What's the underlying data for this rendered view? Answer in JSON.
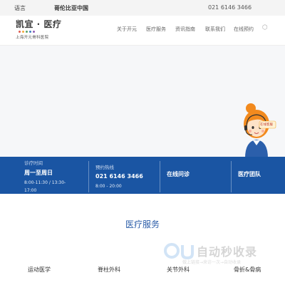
{
  "topbar": {
    "language": "语言",
    "promo": "哥伦比亚中国",
    "phone": "021 6146 3466"
  },
  "header": {
    "logo_name": "凯宜 · 医疗",
    "logo_sub": "上海开元骨科医院",
    "nav": [
      "关于开元",
      "医疗服务",
      "资讯指南",
      "联系我们",
      "在线预约"
    ],
    "nav_icon": "hexagon-icon",
    "dot_colors": [
      "#e05a4f",
      "#f2a93b",
      "#5aa469",
      "#3f7ec4",
      "#8e5bb5"
    ]
  },
  "info": {
    "hours_label": "诊疗时间",
    "hours_days": "周一至周日",
    "hours_time_1": "8:00-11:30 / 13:30-",
    "hours_time_2": "17:00",
    "hotline_label": "预约热线",
    "hotline_phone": "021 6146 3466",
    "hotline_time": "8:00 - 20:00",
    "consult": "在线问诊",
    "team": "医疗团队"
  },
  "services": {
    "title": "医疗服务",
    "items": [
      "运动医学",
      "脊柱外科",
      "关节外科",
      "骨折&骨病"
    ]
  },
  "watermark": {
    "brand": "自动秒收录",
    "slogan": "做上链接→来访一次→自动收录"
  },
  "avatar_badge": "在线客服",
  "colors": {
    "brand_blue": "#1a55a3",
    "title_blue": "#2a5ca8"
  }
}
